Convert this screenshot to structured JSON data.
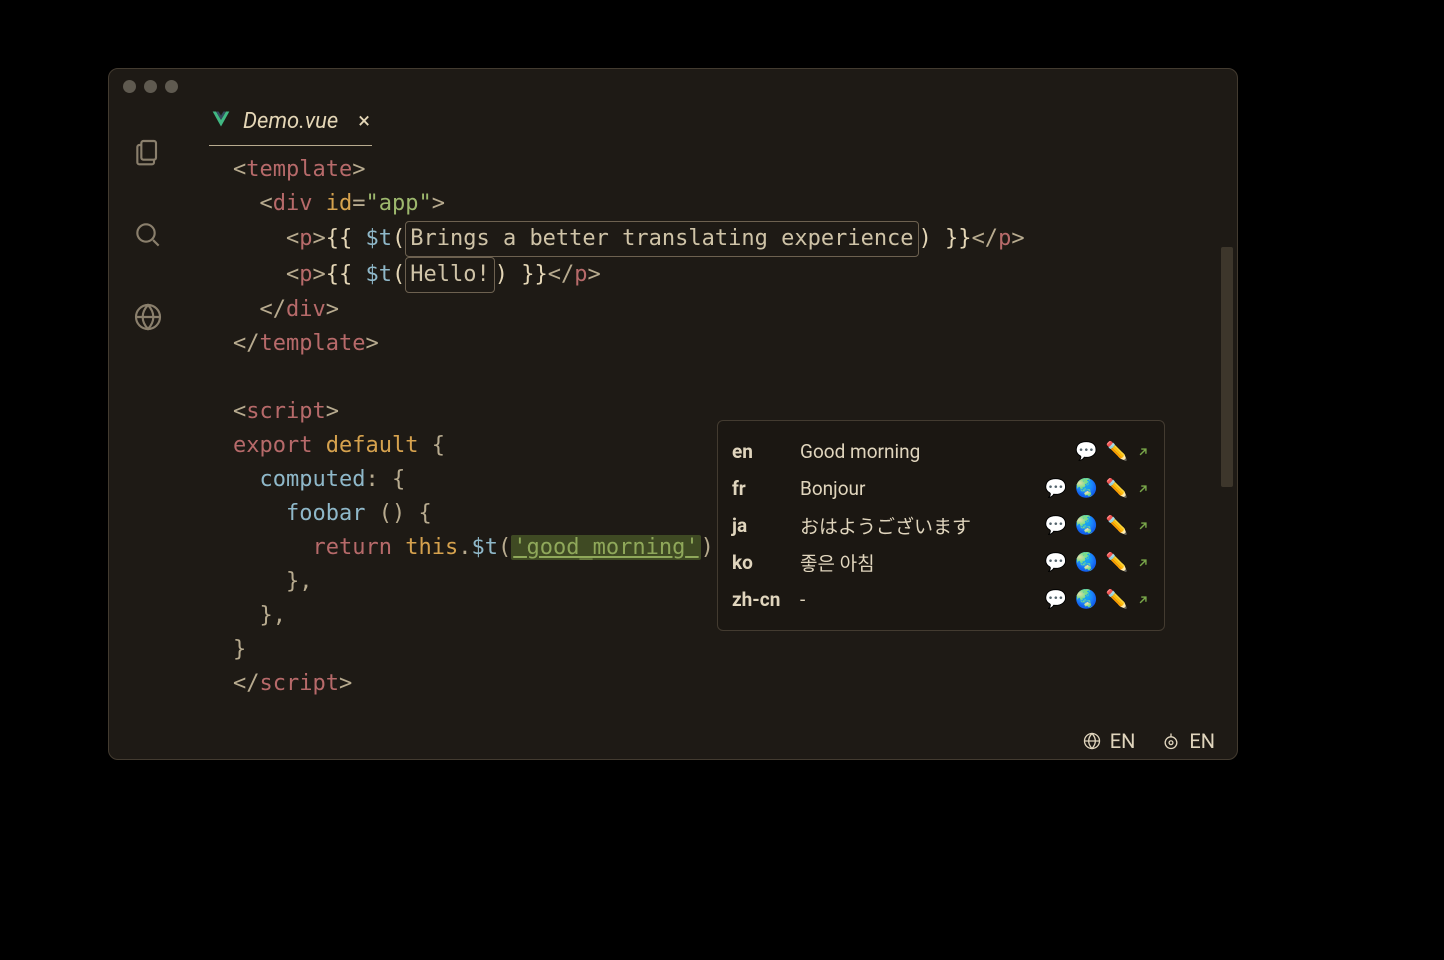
{
  "tab": {
    "filename": "Demo.vue"
  },
  "hints": {
    "line1": "Brings a better translating experience",
    "line2": "Hello!"
  },
  "code": {
    "tpl_open": "template",
    "tpl_close": "template",
    "div": "div",
    "id_attr": "id",
    "id_val": "app",
    "p": "p",
    "mustache_open": "{{ ",
    "mustache_close": " }}",
    "t_call": "$t",
    "script": "script",
    "export": "export",
    "default": "default",
    "computed": "computed",
    "foobar": "foobar",
    "return": "return",
    "this": "this",
    "key": "good_morning"
  },
  "popup": {
    "rows": [
      {
        "lang": "en",
        "value": "Good morning",
        "icons": [
          "speech",
          "pencil",
          "arrow"
        ]
      },
      {
        "lang": "fr",
        "value": "Bonjour",
        "icons": [
          "speech",
          "globe",
          "pencil",
          "arrow"
        ]
      },
      {
        "lang": "ja",
        "value": "おはようございます",
        "icons": [
          "speech",
          "globe",
          "pencil",
          "arrow"
        ]
      },
      {
        "lang": "ko",
        "value": "좋은 아침",
        "icons": [
          "speech",
          "globe",
          "pencil",
          "arrow"
        ]
      },
      {
        "lang": "zh-cn",
        "value": "-",
        "icons": [
          "speech",
          "globe",
          "pencil",
          "arrow"
        ]
      }
    ]
  },
  "statusbar": {
    "left": "EN",
    "right": "EN"
  },
  "icon_glyph": {
    "speech": "💬",
    "globe": "🌏",
    "pencil": "✏️"
  }
}
